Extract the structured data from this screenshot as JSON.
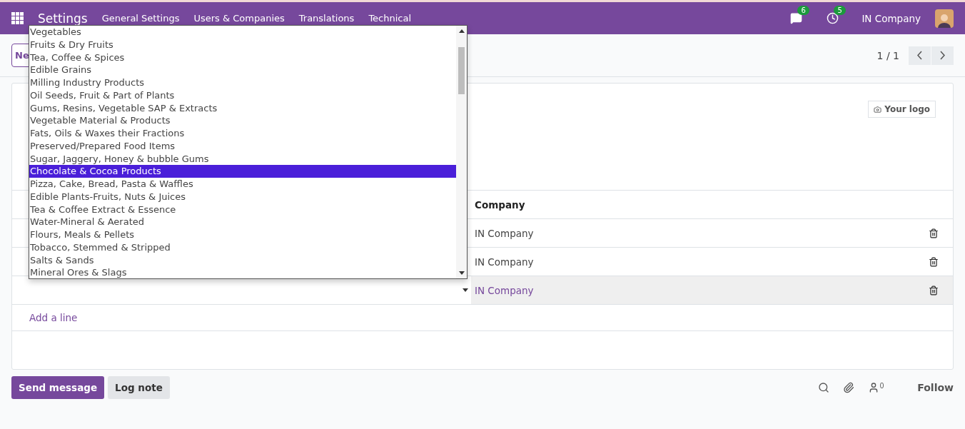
{
  "navbar": {
    "app": "Settings",
    "menus": [
      "General Settings",
      "Users & Companies",
      "Translations",
      "Technical"
    ],
    "messages_badge": "6",
    "activities_badge": "5",
    "company": "IN Company"
  },
  "control_panel": {
    "new_button": "Ne",
    "pager": "1 / 1"
  },
  "form": {
    "logo_button": "Your logo",
    "table": {
      "columns": [
        "Company"
      ],
      "rows": [
        {
          "company": "IN Company",
          "selected": false
        },
        {
          "company": "IN Company",
          "selected": false
        },
        {
          "company": "IN Company",
          "selected": true
        }
      ],
      "add_line": "Add a line"
    },
    "dropdown": {
      "options": [
        {
          "label": "Vegetables",
          "selected": false
        },
        {
          "label": "Fruits & Dry Fruits",
          "selected": false
        },
        {
          "label": "Tea, Coffee & Spices",
          "selected": false
        },
        {
          "label": "Edible Grains",
          "selected": false
        },
        {
          "label": "Milling Industry Products",
          "selected": false
        },
        {
          "label": "Oil Seeds, Fruit & Part of Plants",
          "selected": false
        },
        {
          "label": "Gums, Resins, Vegetable SAP & Extracts",
          "selected": false
        },
        {
          "label": "Vegetable Material & Products",
          "selected": false
        },
        {
          "label": "Fats, Oils & Waxes their Fractions",
          "selected": false
        },
        {
          "label": "Preserved/Prepared Food Items",
          "selected": false
        },
        {
          "label": "Sugar, Jaggery, Honey & bubble Gums",
          "selected": false
        },
        {
          "label": "Chocolate & Cocoa Products",
          "selected": true
        },
        {
          "label": "Pizza, Cake, Bread, Pasta & Waffles",
          "selected": false
        },
        {
          "label": "Edible Plants-Fruits, Nuts & Juices",
          "selected": false
        },
        {
          "label": "Tea & Coffee Extract & Essence",
          "selected": false
        },
        {
          "label": "Water-Mineral & Aerated",
          "selected": false
        },
        {
          "label": "Flours, Meals & Pellets",
          "selected": false
        },
        {
          "label": "Tobacco, Stemmed & Stripped",
          "selected": false
        },
        {
          "label": "Salts & Sands",
          "selected": false
        },
        {
          "label": "Mineral Ores & Slags",
          "selected": false
        }
      ]
    }
  },
  "chatter": {
    "send_message": "Send message",
    "log_note": "Log note",
    "followers_count": "0",
    "follow": "Follow"
  }
}
